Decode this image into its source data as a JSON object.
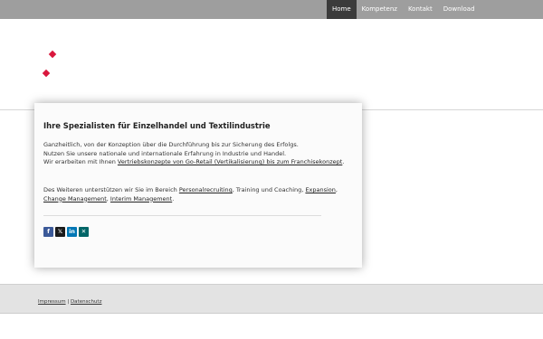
{
  "nav": {
    "items": [
      {
        "label": "Home",
        "active": true
      },
      {
        "label": "Kompetenz",
        "active": false
      },
      {
        "label": "Kontakt",
        "active": false
      },
      {
        "label": "Download",
        "active": false
      }
    ]
  },
  "colors": {
    "topbar": "#9e9e9e",
    "nav_active": "#3b3b3b",
    "logo_accent": "#d9173d",
    "footer": "#e3e3e3"
  },
  "main": {
    "title": "Ihre Spezialisten für Einzelhandel und Textilindustrie",
    "p1_line1": "Ganzheitlich, von der Konzeption über die Durchführung bis zur Sicherung des Erfolgs.",
    "p1_line2": "Nutzen Sie unsere nationale und internationale Erfahrung in Industrie und Handel.",
    "p1_line3_pre": "Wir erarbeiten mit Ihnen ",
    "p1_link": "Vertriebskonzepte von Go-Retail (Vertikalisierung) bis zum Franchisekonzept",
    "p1_line3_post": ".",
    "p2_pre": "Des Weiteren unterstützen wir Sie im Bereich ",
    "p2_link1": "Personalrecruiting",
    "p2_mid1": ", Training und Coaching, ",
    "p2_link2": "Expansion",
    "p2_mid2": ", ",
    "p2_link3": "Change Management",
    "p2_mid3": ", ",
    "p2_link4": "Interim Management",
    "p2_post": "."
  },
  "share": {
    "icons": [
      "facebook-icon",
      "x-icon",
      "linkedin-icon",
      "xing-icon"
    ],
    "facebook_glyph": "f",
    "x_glyph": "𝕏",
    "linkedin_glyph": "in",
    "xing_glyph": "✕"
  },
  "footer": {
    "impressum": "Impressum",
    "separator": " | ",
    "datenschutz": "Datenschutz"
  }
}
